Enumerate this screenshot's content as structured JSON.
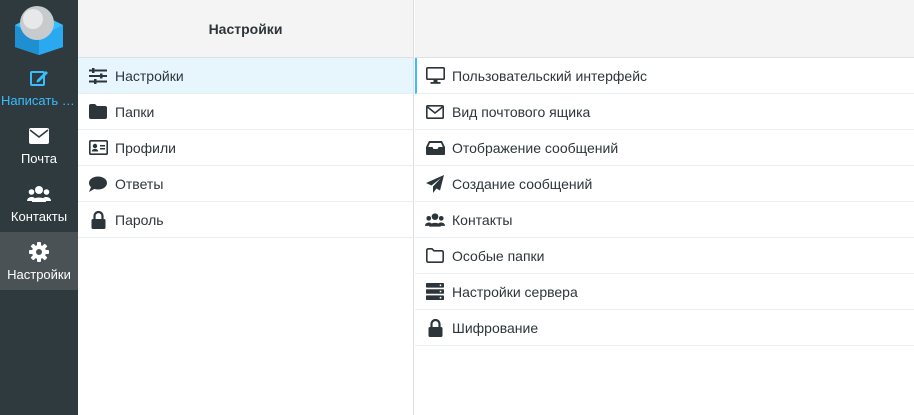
{
  "nav": {
    "compose": {
      "label": "Написать с...",
      "icon": "compose-icon"
    },
    "mail": {
      "label": "Почта",
      "icon": "envelope-icon"
    },
    "contacts": {
      "label": "Контакты",
      "icon": "users-icon"
    },
    "settings": {
      "label": "Настройки",
      "icon": "gear-icon"
    }
  },
  "list": {
    "title": "Настройки",
    "items": [
      {
        "label": "Настройки",
        "icon": "sliders-icon"
      },
      {
        "label": "Папки",
        "icon": "folder-icon"
      },
      {
        "label": "Профили",
        "icon": "id-card-icon"
      },
      {
        "label": "Ответы",
        "icon": "comment-icon"
      },
      {
        "label": "Пароль",
        "icon": "lock-icon"
      }
    ]
  },
  "sections": {
    "items": [
      {
        "label": "Пользовательский интерфейс",
        "icon": "monitor-icon"
      },
      {
        "label": "Вид почтового ящика",
        "icon": "envelope-outline-icon"
      },
      {
        "label": "Отображение сообщений",
        "icon": "inbox-icon"
      },
      {
        "label": "Создание сообщений",
        "icon": "paper-plane-icon"
      },
      {
        "label": "Контакты",
        "icon": "users-icon"
      },
      {
        "label": "Особые папки",
        "icon": "folder-outline-icon"
      },
      {
        "label": "Настройки сервера",
        "icon": "server-icon"
      },
      {
        "label": "Шифрование",
        "icon": "lock-icon"
      }
    ]
  },
  "colors": {
    "rail": "#2f3a3f",
    "accent": "#37beff",
    "active": "#4a5256",
    "selected_row": "#e7f6fd"
  }
}
